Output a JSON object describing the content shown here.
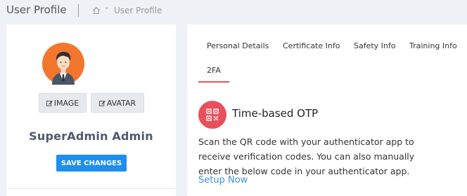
{
  "header": {
    "title": "User Profile",
    "breadcrumb": {
      "home_icon": "home-icon",
      "current": "User Profile"
    }
  },
  "profile_card": {
    "avatar_icon": "avatar",
    "image_button": "IMAGE",
    "avatar_button": "AVATAR",
    "edit_icon": "edit-icon",
    "user_name": "SuperAdmin Admin",
    "save_button": "SAVE CHANGES"
  },
  "tabs": [
    {
      "label": "Personal Details",
      "active": false
    },
    {
      "label": "Certificate Info",
      "active": false
    },
    {
      "label": "Safety Info",
      "active": false
    },
    {
      "label": "Training Info",
      "active": false
    },
    {
      "label": "2FA",
      "active": true
    }
  ],
  "otp": {
    "icon": "qr-code-icon",
    "title": "Time-based OTP",
    "description": "Scan the QR code with your authenticator app to receive verification codes. You can also manually enter the below code in your authenticator app.",
    "setup_link": "Setup Now"
  },
  "colors": {
    "accent": "#e8505b",
    "primary_button": "#1e8ef0",
    "link": "#3b8fd6",
    "background": "#eef1f5"
  }
}
